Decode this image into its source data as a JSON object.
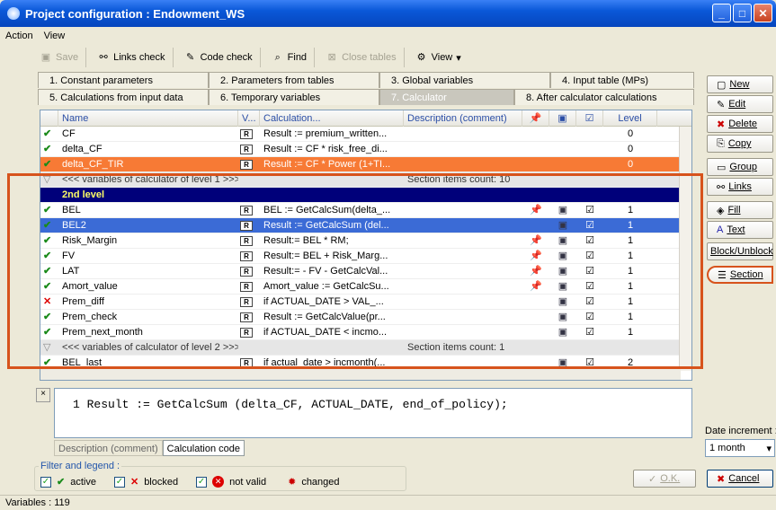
{
  "window": {
    "title": "Project configuration : Endowment_WS"
  },
  "menu": [
    "Action",
    "View"
  ],
  "toolbar": {
    "save": "Save",
    "links_check": "Links check",
    "code_check": "Code check",
    "find": "Find",
    "close_tables": "Close tables",
    "view": "View"
  },
  "tabs_row1": [
    "1. Constant parameters",
    "2. Parameters from tables",
    "3. Global variables",
    "4. Input table (MPs)"
  ],
  "tabs_row2": [
    "5. Calculations from input data",
    "6. Temporary variables",
    "7. Calculator",
    "8. After calculator calculations"
  ],
  "grid": {
    "headers": [
      "Name",
      "V...",
      "Calculation...",
      "Description (comment)",
      "Level"
    ],
    "rows": [
      {
        "status": "active",
        "name": "CF",
        "v": "R",
        "calc": "Result := premium_written...",
        "desc": "",
        "pin": false,
        "disk": false,
        "chk": false,
        "level": "0"
      },
      {
        "status": "active",
        "name": "delta_CF",
        "v": "R",
        "calc": "Result := CF * risk_free_di...",
        "desc": "",
        "pin": false,
        "disk": false,
        "chk": false,
        "level": "0"
      },
      {
        "status": "active",
        "name": "delta_CF_TIR",
        "v": "R",
        "calc": "Result := CF * Power (1+TI...",
        "desc": "",
        "pin": false,
        "disk": false,
        "chk": false,
        "level": "0",
        "style": "orange"
      },
      {
        "status": "section",
        "name": "<<< variables of calculator of level 1 >>>",
        "v": "",
        "calc": "",
        "desc": "Section items count: 10",
        "level": "",
        "style": "section"
      },
      {
        "status": "",
        "name": "2nd level",
        "v": "",
        "calc": "",
        "desc": "",
        "level": "",
        "style": "header2"
      },
      {
        "status": "active",
        "name": "BEL",
        "v": "R",
        "calc": "BEL := GetCalcSum(delta_...",
        "desc": "",
        "pin": true,
        "disk": true,
        "chk": true,
        "level": "1"
      },
      {
        "status": "active",
        "name": "BEL2",
        "v": "R",
        "calc": "Result := GetCalcSum (del...",
        "desc": "",
        "pin": false,
        "disk": true,
        "chk": true,
        "level": "1",
        "style": "selected"
      },
      {
        "status": "active",
        "name": "Risk_Margin",
        "v": "R",
        "calc": "Result:= BEL * RM;",
        "desc": "",
        "pin": true,
        "disk": true,
        "chk": true,
        "level": "1"
      },
      {
        "status": "active",
        "name": "FV",
        "v": "R",
        "calc": "Result:= BEL + Risk_Marg...",
        "desc": "",
        "pin": true,
        "disk": true,
        "chk": true,
        "level": "1"
      },
      {
        "status": "active",
        "name": "LAT",
        "v": "R",
        "calc": "Result:= - FV - GetCalcVal...",
        "desc": "",
        "pin": true,
        "disk": true,
        "chk": true,
        "level": "1"
      },
      {
        "status": "active",
        "name": "Amort_value",
        "v": "R",
        "calc": "Amort_value := GetCalcSu...",
        "desc": "",
        "pin": true,
        "disk": true,
        "chk": true,
        "level": "1"
      },
      {
        "status": "blocked",
        "name": "Prem_diff",
        "v": "R",
        "calc": "if ACTUAL_DATE > VAL_...",
        "desc": "",
        "pin": false,
        "disk": true,
        "chk": true,
        "level": "1"
      },
      {
        "status": "active",
        "name": "Prem_check",
        "v": "R",
        "calc": "Result := GetCalcValue(pr...",
        "desc": "",
        "pin": false,
        "disk": true,
        "chk": true,
        "level": "1"
      },
      {
        "status": "active",
        "name": "Prem_next_month",
        "v": "R",
        "calc": "if ACTUAL_DATE < incmo...",
        "desc": "",
        "pin": false,
        "disk": true,
        "chk": true,
        "level": "1"
      },
      {
        "status": "section",
        "name": "<<< variables of calculator of level 2 >>>",
        "v": "",
        "calc": "",
        "desc": "Section items count: 1",
        "level": "",
        "style": "section"
      },
      {
        "status": "active",
        "name": "BEL_last",
        "v": "R",
        "calc": "if actual_date > incmonth(...",
        "desc": "",
        "pin": false,
        "disk": true,
        "chk": true,
        "level": "2"
      }
    ]
  },
  "editor": {
    "line_no": "1",
    "code": "Result := GetCalcSum (delta_CF, ACTUAL_DATE, end_of_policy);"
  },
  "bottom_tabs": [
    "Description (comment)",
    "Calculation code"
  ],
  "right_buttons": [
    "New",
    "Edit",
    "Delete",
    "Copy",
    "Group",
    "Links",
    "Fill",
    "Text",
    "Block/Unblock",
    "Section"
  ],
  "date_increment": {
    "label": "Date increment :",
    "value": "1 month"
  },
  "legend": {
    "title": "Filter and legend :",
    "active": "active",
    "blocked": "blocked",
    "not_valid": "not valid",
    "changed": "changed"
  },
  "ok_button": "O.K.",
  "cancel_button": "Cancel",
  "status": "Variables : 119"
}
